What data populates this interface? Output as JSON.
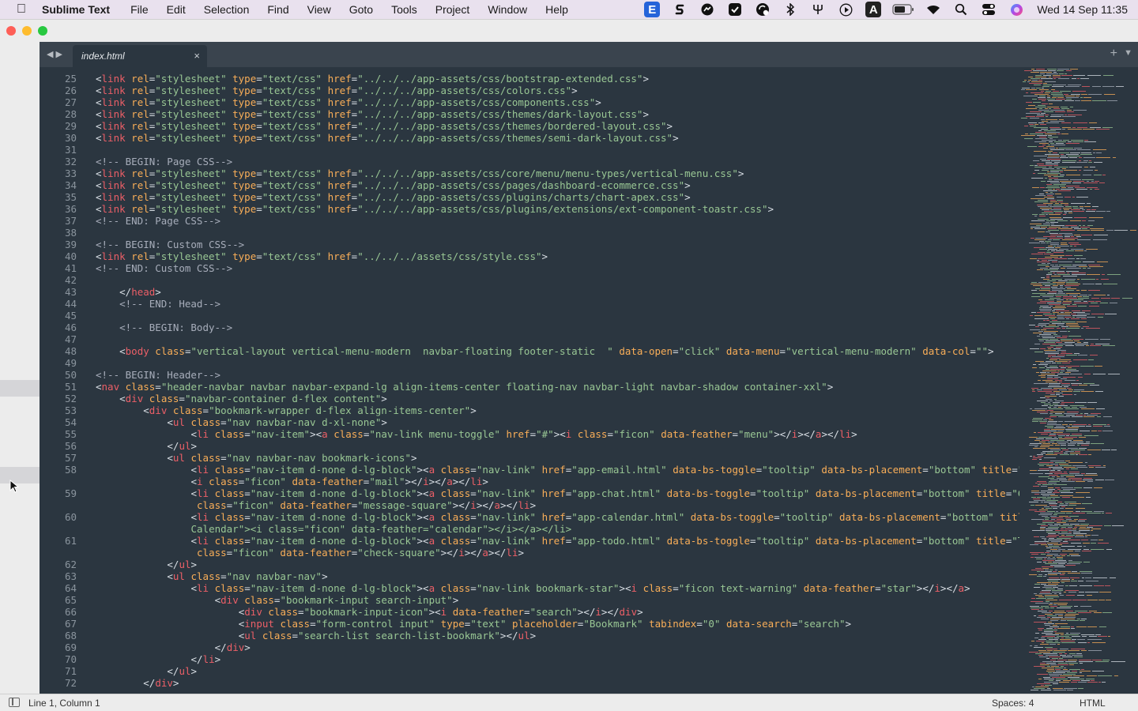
{
  "menubar": {
    "app": "Sublime Text",
    "items": [
      "File",
      "Edit",
      "Selection",
      "Find",
      "View",
      "Goto",
      "Tools",
      "Project",
      "Window",
      "Help"
    ],
    "status_icons": [
      "e-tile-icon",
      "s-logo-icon",
      "messenger-icon",
      "checkmark-icon",
      "sync-badge-icon",
      "bluetooth-icon",
      "fork-icon",
      "play-icon",
      "text-tile-icon",
      "battery-icon",
      "wifi-icon",
      "spotlight-search-icon",
      "control-center-icon",
      "siri-icon"
    ],
    "e_tile": "E",
    "a_tile": "A",
    "clock": "Wed 14 Sep  11:35"
  },
  "tab": {
    "label": "index.html",
    "close": "×",
    "plus": "+",
    "dropdown": "▼"
  },
  "editor": {
    "lines": [
      {
        "n": "25",
        "code": "        <link rel=\"stylesheet\" type=\"text/css\" href=\"../../../app-assets/css/bootstrap-extended.css\">"
      },
      {
        "n": "26",
        "code": "        <link rel=\"stylesheet\" type=\"text/css\" href=\"../../../app-assets/css/colors.css\">"
      },
      {
        "n": "27",
        "code": "        <link rel=\"stylesheet\" type=\"text/css\" href=\"../../../app-assets/css/components.css\">"
      },
      {
        "n": "28",
        "code": "        <link rel=\"stylesheet\" type=\"text/css\" href=\"../../../app-assets/css/themes/dark-layout.css\">"
      },
      {
        "n": "29",
        "code": "        <link rel=\"stylesheet\" type=\"text/css\" href=\"../../../app-assets/css/themes/bordered-layout.css\">"
      },
      {
        "n": "30",
        "code": "        <link rel=\"stylesheet\" type=\"text/css\" href=\"../../../app-assets/css/themes/semi-dark-layout.css\">"
      },
      {
        "n": "31",
        "code": ""
      },
      {
        "n": "32",
        "code": "        <!-- BEGIN: Page CSS-->"
      },
      {
        "n": "33",
        "code": "        <link rel=\"stylesheet\" type=\"text/css\" href=\"../../../app-assets/css/core/menu/menu-types/vertical-menu.css\">"
      },
      {
        "n": "34",
        "code": "        <link rel=\"stylesheet\" type=\"text/css\" href=\"../../../app-assets/css/pages/dashboard-ecommerce.css\">"
      },
      {
        "n": "35",
        "code": "        <link rel=\"stylesheet\" type=\"text/css\" href=\"../../../app-assets/css/plugins/charts/chart-apex.css\">"
      },
      {
        "n": "36",
        "code": "        <link rel=\"stylesheet\" type=\"text/css\" href=\"../../../app-assets/css/plugins/extensions/ext-component-toastr.css\">"
      },
      {
        "n": "37",
        "code": "        <!-- END: Page CSS-->"
      },
      {
        "n": "38",
        "code": ""
      },
      {
        "n": "39",
        "code": "        <!-- BEGIN: Custom CSS-->"
      },
      {
        "n": "40",
        "code": "        <link rel=\"stylesheet\" type=\"text/css\" href=\"../../../assets/css/style.css\">"
      },
      {
        "n": "41",
        "code": "        <!-- END: Custom CSS-->"
      },
      {
        "n": "42",
        "code": ""
      },
      {
        "n": "43",
        "code": "    </head>"
      },
      {
        "n": "44",
        "code": "    <!-- END: Head-->"
      },
      {
        "n": "45",
        "code": ""
      },
      {
        "n": "46",
        "code": "    <!-- BEGIN: Body-->"
      },
      {
        "n": "47",
        "code": ""
      },
      {
        "n": "48",
        "code": "    <body class=\"vertical-layout vertical-menu-modern  navbar-floating footer-static  \" data-open=\"click\" data-menu=\"vertical-menu-modern\" data-col=\"\">"
      },
      {
        "n": "49",
        "code": ""
      },
      {
        "n": "50",
        "code": "        <!-- BEGIN: Header-->"
      },
      {
        "n": "51",
        "code": "        <nav class=\"header-navbar navbar navbar-expand-lg align-items-center floating-nav navbar-light navbar-shadow container-xxl\">"
      },
      {
        "n": "52",
        "code": "            <div class=\"navbar-container d-flex content\">"
      },
      {
        "n": "53",
        "code": "                <div class=\"bookmark-wrapper d-flex align-items-center\">"
      },
      {
        "n": "54",
        "code": "                    <ul class=\"nav navbar-nav d-xl-none\">"
      },
      {
        "n": "55",
        "code": "                        <li class=\"nav-item\"><a class=\"nav-link menu-toggle\" href=\"#\"><i class=\"ficon\" data-feather=\"menu\"></i></a></li>"
      },
      {
        "n": "56",
        "code": "                    </ul>"
      },
      {
        "n": "57",
        "code": "                    <ul class=\"nav navbar-nav bookmark-icons\">"
      },
      {
        "n": "58",
        "code": "                        <li class=\"nav-item d-none d-lg-block\"><a class=\"nav-link\" href=\"app-email.html\" data-bs-toggle=\"tooltip\" data-bs-placement=\"bottom\" title=\"Email\">"
      },
      {
        "n": "",
        "code": "                        <i class=\"ficon\" data-feather=\"mail\"></i></a></li>"
      },
      {
        "n": "59",
        "code": "                        <li class=\"nav-item d-none d-lg-block\"><a class=\"nav-link\" href=\"app-chat.html\" data-bs-toggle=\"tooltip\" data-bs-placement=\"bottom\" title=\"Chat\"><i"
      },
      {
        "n": "",
        "code": "                         class=\"ficon\" data-feather=\"message-square\"></i></a></li>"
      },
      {
        "n": "60",
        "code": "                        <li class=\"nav-item d-none d-lg-block\"><a class=\"nav-link\" href=\"app-calendar.html\" data-bs-toggle=\"tooltip\" data-bs-placement=\"bottom\" title=\""
      },
      {
        "n": "",
        "code": "                        Calendar\"><i class=\"ficon\" data-feather=\"calendar\"></i></a></li>"
      },
      {
        "n": "61",
        "code": "                        <li class=\"nav-item d-none d-lg-block\"><a class=\"nav-link\" href=\"app-todo.html\" data-bs-toggle=\"tooltip\" data-bs-placement=\"bottom\" title=\"Todo\"><i"
      },
      {
        "n": "",
        "code": "                         class=\"ficon\" data-feather=\"check-square\"></i></a></li>"
      },
      {
        "n": "62",
        "code": "                    </ul>"
      },
      {
        "n": "63",
        "code": "                    <ul class=\"nav navbar-nav\">"
      },
      {
        "n": "64",
        "code": "                        <li class=\"nav-item d-none d-lg-block\"><a class=\"nav-link bookmark-star\"><i class=\"ficon text-warning\" data-feather=\"star\"></i></a>"
      },
      {
        "n": "65",
        "code": "                            <div class=\"bookmark-input search-input\">"
      },
      {
        "n": "66",
        "code": "                                <div class=\"bookmark-input-icon\"><i data-feather=\"search\"></i></div>"
      },
      {
        "n": "67",
        "code": "                                <input class=\"form-control input\" type=\"text\" placeholder=\"Bookmark\" tabindex=\"0\" data-search=\"search\">"
      },
      {
        "n": "68",
        "code": "                                <ul class=\"search-list search-list-bookmark\"></ul>"
      },
      {
        "n": "69",
        "code": "                            </div>"
      },
      {
        "n": "70",
        "code": "                        </li>"
      },
      {
        "n": "71",
        "code": "                    </ul>"
      },
      {
        "n": "72",
        "code": "                </div>"
      }
    ]
  },
  "statusbar": {
    "position": "Line 1, Column 1",
    "spaces": "Spaces: 4",
    "syntax": "HTML"
  },
  "colors": {
    "editor_bg": "#2b3640",
    "tag": "#ec5f67",
    "attr": "#f9ae58",
    "string": "#99c794",
    "comment": "#a7adba",
    "line_number": "#8a949d"
  }
}
